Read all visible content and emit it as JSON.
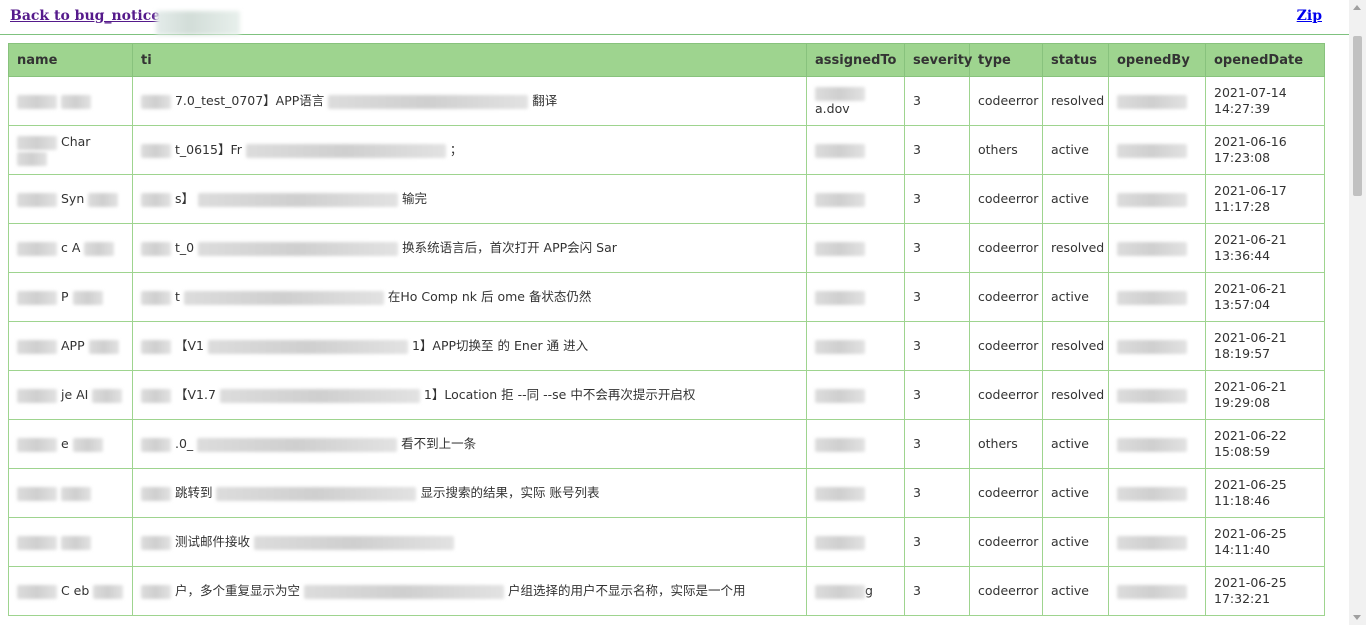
{
  "links": {
    "back": "Back to bug_notice",
    "zip": "Zip"
  },
  "table": {
    "headers": [
      "name",
      "ti",
      "assignedTo",
      "severity",
      "type",
      "status",
      "openedBy",
      "openedDate"
    ],
    "rows": [
      {
        "name": "",
        "title": "7.0_test_0707】APP语言",
        "title_tail": "翻译",
        "severity": "3",
        "type": "codeerror",
        "status": "resolved",
        "date": "2021-07-14",
        "time": "14:27:39",
        "assigned": "a.dov"
      },
      {
        "name": "Char",
        "title": "t_0615】Fr",
        "title_tail": "；",
        "severity": "3",
        "type": "others",
        "status": "active",
        "date": "2021-06-16",
        "time": "17:23:08",
        "assigned": ""
      },
      {
        "name": "Syn",
        "title": "s】",
        "title_tail": "输完",
        "severity": "3",
        "type": "codeerror",
        "status": "active",
        "date": "2021-06-17",
        "time": "11:17:28",
        "assigned": ""
      },
      {
        "name": "c A",
        "title": "t_0",
        "title_tail": "换系统语言后，首次打开  APP会闪  Sar",
        "severity": "3",
        "type": "codeerror",
        "status": "resolved",
        "date": "2021-06-21",
        "time": "13:36:44",
        "assigned": ""
      },
      {
        "name": "P",
        "title": "t",
        "title_tail": "在Ho  Comp  nk  后  ome  备状态仍然",
        "severity": "3",
        "type": "codeerror",
        "status": "active",
        "date": "2021-06-21",
        "time": "13:57:04",
        "assigned": ""
      },
      {
        "name": "APP",
        "title": "【V1",
        "title_tail": "1】APP切换至  的 Ener  通  进入",
        "severity": "3",
        "type": "codeerror",
        "status": "resolved",
        "date": "2021-06-21",
        "time": "18:19:57",
        "assigned": ""
      },
      {
        "name": "je  AI",
        "title": "【V1.7",
        "title_tail": "1】Location  拒  --同  --se  中不会再次提示开启权",
        "severity": "3",
        "type": "codeerror",
        "status": "resolved",
        "date": "2021-06-21",
        "time": "19:29:08",
        "assigned": ""
      },
      {
        "name": "e",
        "title": ".0_",
        "title_tail": "看不到上一条",
        "severity": "3",
        "type": "others",
        "status": "active",
        "date": "2021-06-22",
        "time": "15:08:59",
        "assigned": ""
      },
      {
        "name": "",
        "title": "跳转到",
        "title_tail": "显示搜索的结果，实际   账号列表",
        "severity": "3",
        "type": "codeerror",
        "status": "active",
        "date": "2021-06-25",
        "time": "11:18:46",
        "assigned": ""
      },
      {
        "name": "",
        "title": "测试邮件接收",
        "title_tail": "",
        "severity": "3",
        "type": "codeerror",
        "status": "active",
        "date": "2021-06-25",
        "time": "14:11:40",
        "assigned": ""
      },
      {
        "name": "C  eb",
        "title": "户，多个重复显示为空",
        "title_tail": "户组选择的用户不显示名称，实际是一个用",
        "severity": "3",
        "type": "codeerror",
        "status": "active",
        "date": "2021-06-25",
        "time": "17:32:21",
        "assigned": "g"
      }
    ]
  },
  "colors": {
    "header_bg": "#9ed48f",
    "border": "#9ed48f",
    "back_link": "#551a8b",
    "zip_link": "#0000ee"
  }
}
